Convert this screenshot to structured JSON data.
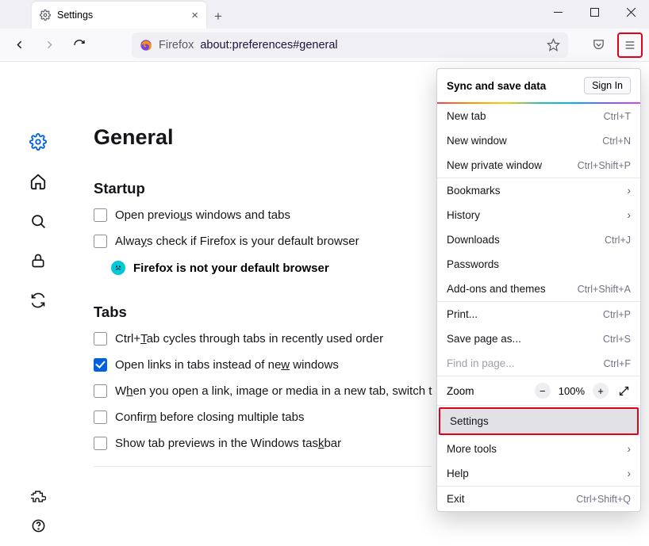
{
  "tab": {
    "title": "Settings"
  },
  "url": {
    "identity_label": "Firefox",
    "address": "about:preferences#general"
  },
  "page": {
    "title": "General",
    "startup": {
      "heading": "Startup",
      "open_previous": {
        "pre": "Open previo",
        "u": "u",
        "post": "s windows and tabs"
      },
      "always_check": {
        "pre": "Alwa",
        "u": "y",
        "post": "s check if Firefox is your default browser"
      },
      "not_default": "Firefox is not your default browser"
    },
    "tabs": {
      "heading": "Tabs",
      "ctrltab": {
        "pre": "Ctrl+",
        "u": "T",
        "post": "ab cycles through tabs in recently used order"
      },
      "open_links": {
        "pre": "Open links in tabs instead of ne",
        "u": "w",
        "post": " windows"
      },
      "switch": {
        "pre": "W",
        "u": "h",
        "post": "en you open a link, image or media in a new tab, switch t"
      },
      "confirm": {
        "pre": "Confir",
        "u": "m",
        "post": " before closing multiple tabs"
      },
      "previews": {
        "pre": "Show tab previews in the Windows tas",
        "u": "k",
        "post": "bar"
      }
    }
  },
  "menu": {
    "sync_header": "Sync and save data",
    "sign_in": "Sign In",
    "new_tab": "New tab",
    "new_tab_sc": "Ctrl+T",
    "new_window": "New window",
    "new_window_sc": "Ctrl+N",
    "new_private": "New private window",
    "new_private_sc": "Ctrl+Shift+P",
    "bookmarks": "Bookmarks",
    "history": "History",
    "downloads": "Downloads",
    "downloads_sc": "Ctrl+J",
    "passwords": "Passwords",
    "addons": "Add-ons and themes",
    "addons_sc": "Ctrl+Shift+A",
    "print": "Print...",
    "print_sc": "Ctrl+P",
    "save_as": "Save page as...",
    "save_as_sc": "Ctrl+S",
    "find": "Find in page...",
    "find_sc": "Ctrl+F",
    "zoom": "Zoom",
    "zoom_value": "100%",
    "settings": "Settings",
    "more_tools": "More tools",
    "help": "Help",
    "exit": "Exit",
    "exit_sc": "Ctrl+Shift+Q"
  }
}
